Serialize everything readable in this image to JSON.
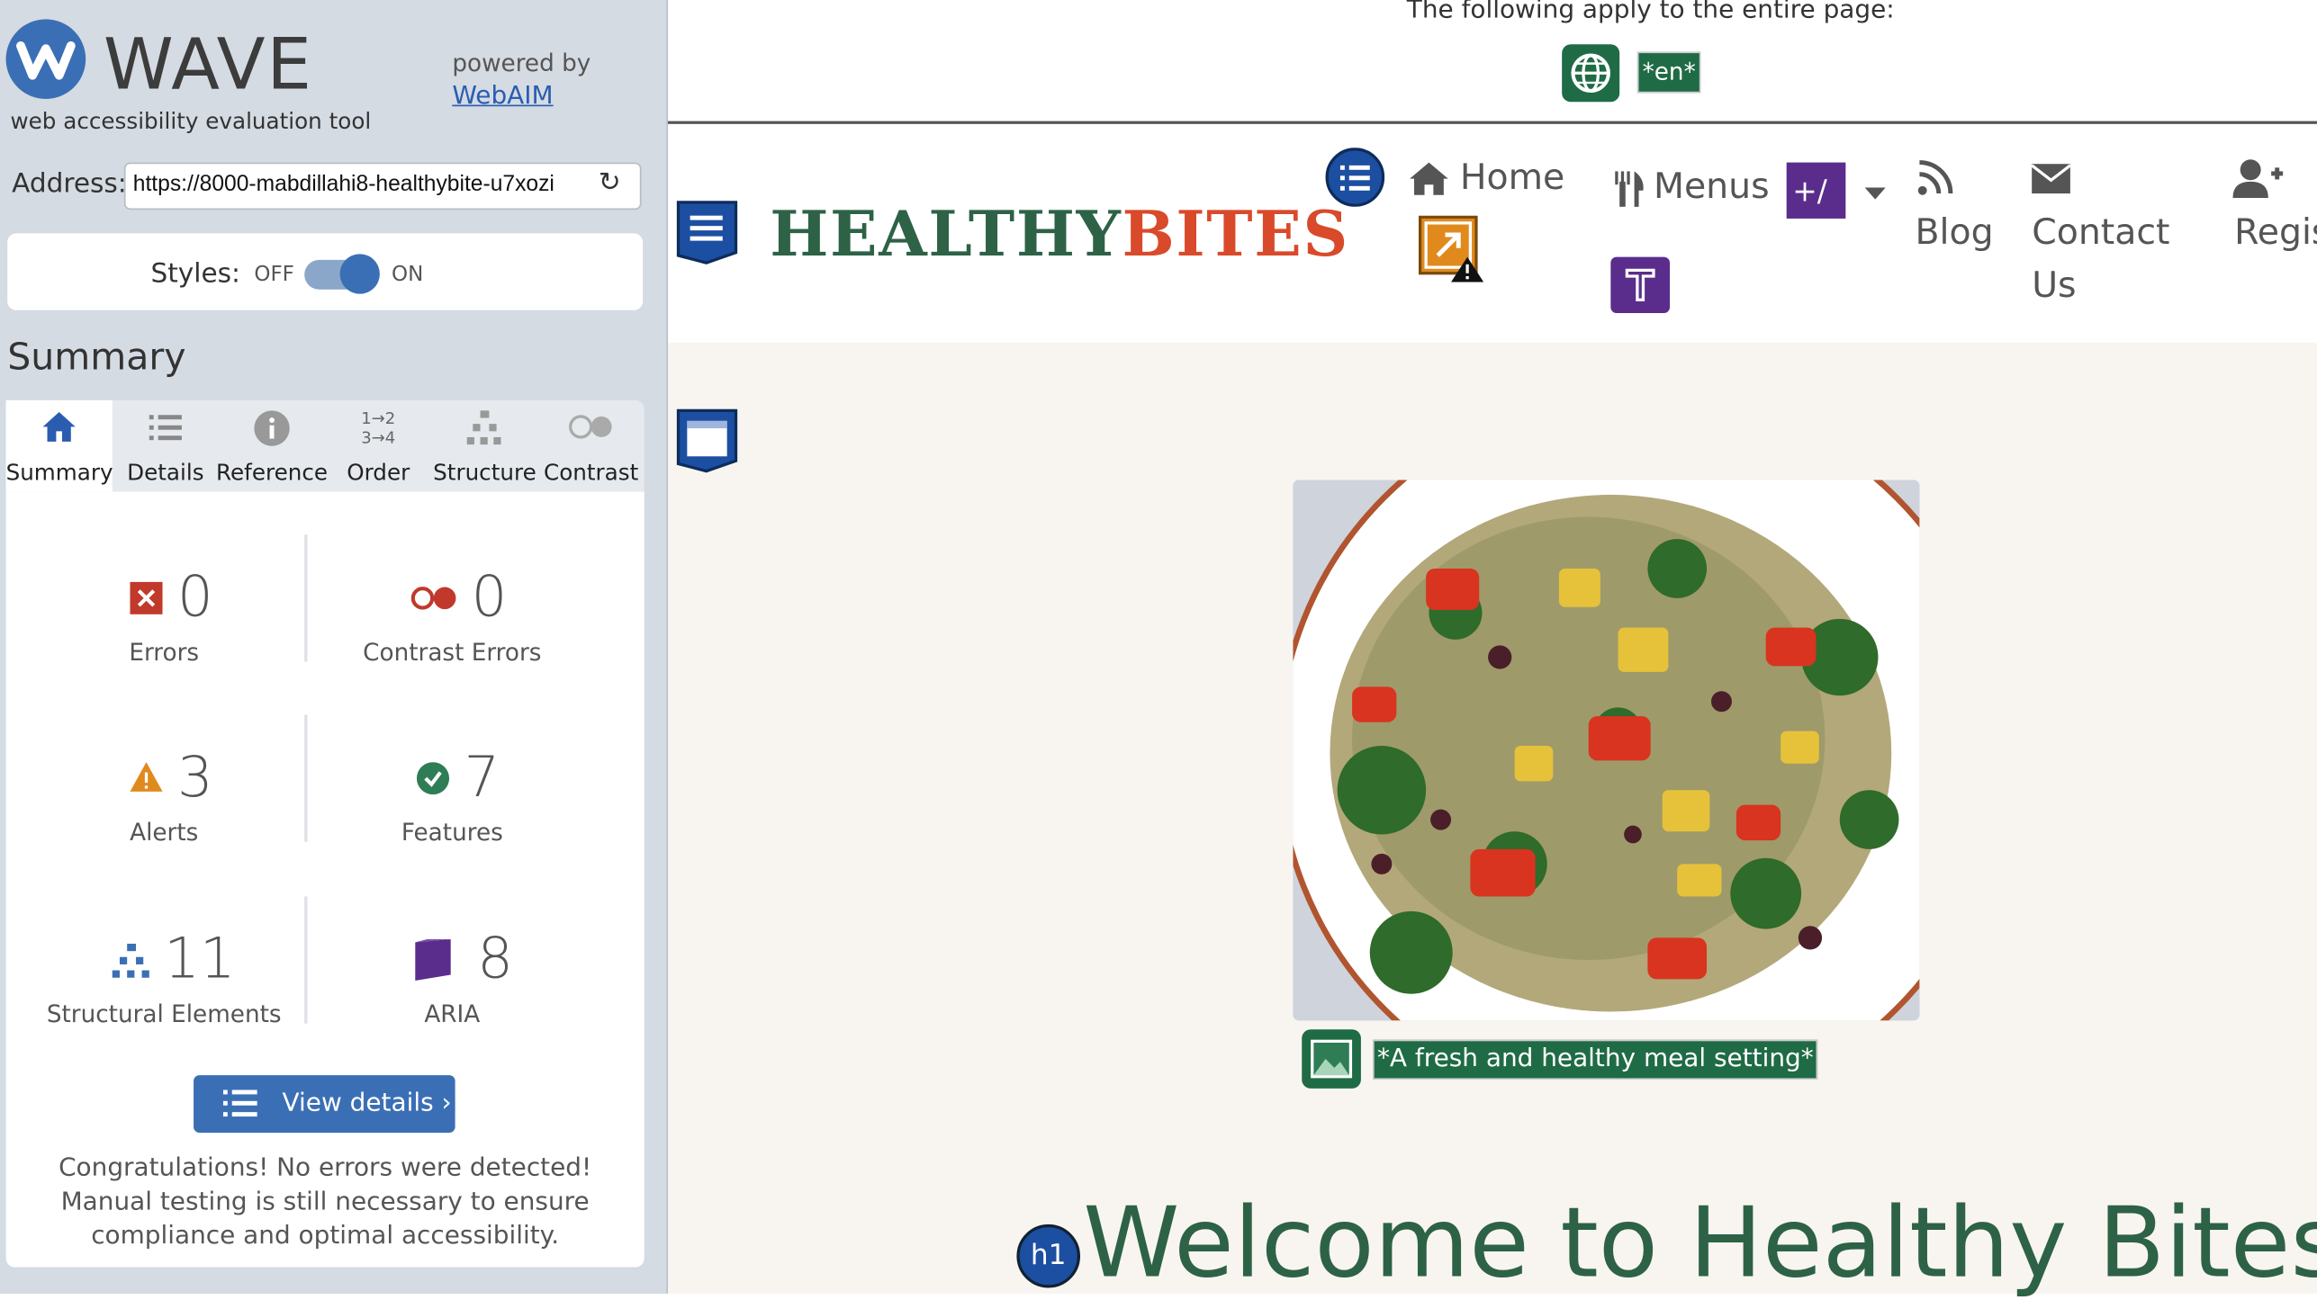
{
  "wave": {
    "title": "WAVE",
    "tagline": "web accessibility evaluation tool",
    "powered_by": "powered by",
    "webaim": "WebAIM",
    "address_label": "Address:",
    "address_value": "https://8000-mabdillahi8-healthybite-u7xozi",
    "styles_label": "Styles:",
    "styles_off": "OFF",
    "styles_on": "ON",
    "summary_heading": "Summary",
    "tabs": [
      {
        "label": "Summary",
        "icon": "home-icon"
      },
      {
        "label": "Details",
        "icon": "list-icon"
      },
      {
        "label": "Reference",
        "icon": "info-icon"
      },
      {
        "label": "Order",
        "icon": "order-icon"
      },
      {
        "label": "Structure",
        "icon": "structure-icon"
      },
      {
        "label": "Contrast",
        "icon": "contrast-icon"
      }
    ],
    "stats": {
      "errors": {
        "value": "0",
        "label": "Errors"
      },
      "contrast_errors": {
        "value": "0",
        "label": "Contrast Errors"
      },
      "alerts": {
        "value": "3",
        "label": "Alerts"
      },
      "features": {
        "value": "7",
        "label": "Features"
      },
      "structural": {
        "value": "11",
        "label": "Structural Elements"
      },
      "aria": {
        "value": "8",
        "label": "ARIA"
      }
    },
    "view_details": "View details ›",
    "congrats": "Congratulations! No errors were detected! Manual testing is still necessary to ensure compliance and optimal accessibility.",
    "colors": {
      "accent": "#3b6fb5",
      "error": "#c0392b",
      "alert": "#e08a1e",
      "feature": "#1f6b45",
      "aria": "#5a2d8c"
    }
  },
  "page": {
    "banner_text": "The following apply to the entire page:",
    "lang_badge": "*en*",
    "logo_part1": "HEALTHY",
    "logo_part2": "BITES",
    "nav": {
      "home": "Home",
      "menus": "Menus",
      "blog": "Blog",
      "contact_line1": "Contact",
      "contact_line2": "Us",
      "register": "Regis"
    },
    "aria_expand_label": "+/−",
    "alt_text": "*A fresh and healthy meal setting*",
    "h1_badge": "h1",
    "welcome": "Welcome to Healthy Bites",
    "colors": {
      "brand_green": "#2d6246",
      "brand_orange": "#d94a2b",
      "hero_bg": "#f8f5f0"
    }
  }
}
